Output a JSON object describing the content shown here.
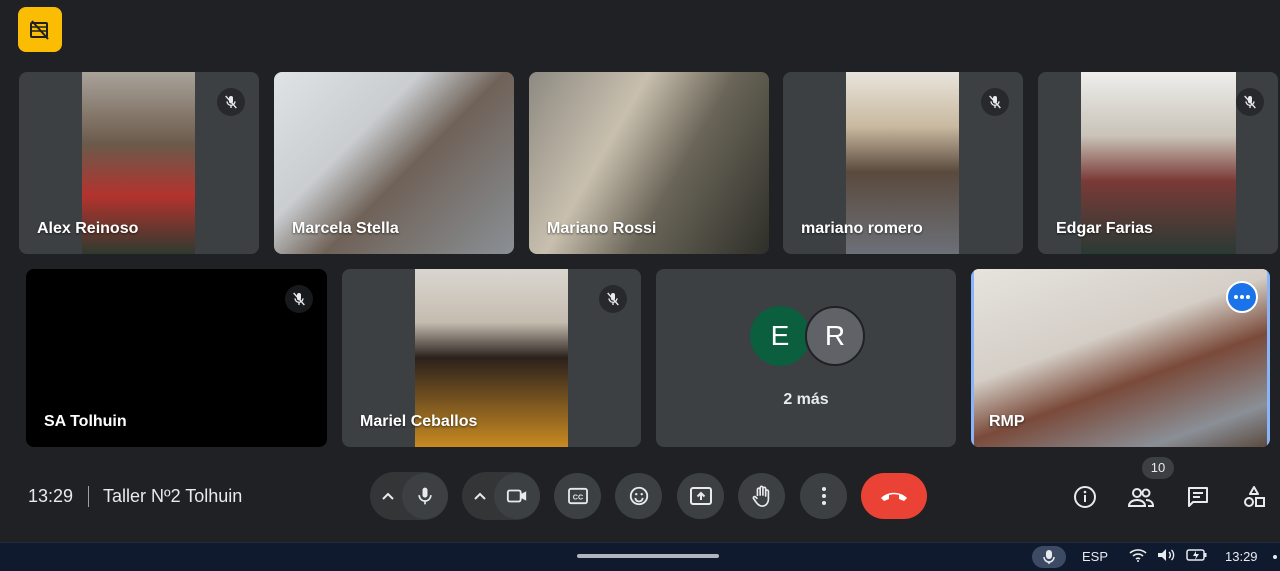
{
  "meeting": {
    "time": "13:29",
    "title": "Taller Nº2 Tolhuin",
    "participant_count": "10"
  },
  "participants_row1": [
    {
      "name": "Alex Reinoso",
      "muted": true
    },
    {
      "name": "Marcela Stella",
      "muted": false
    },
    {
      "name": "Mariano Rossi",
      "muted": false
    },
    {
      "name": "mariano romero",
      "muted": true
    },
    {
      "name": "Edgar Farias",
      "muted": true
    }
  ],
  "participants_row2": [
    {
      "name": "SA Tolhuin",
      "muted": true
    },
    {
      "name": "Mariel Ceballos",
      "muted": true
    },
    {
      "overflow_initials": [
        "E",
        "R"
      ],
      "label": "2 más"
    },
    {
      "name": "RMP",
      "muted": false
    }
  ],
  "colors": {
    "background": "#202124",
    "tile": "#3c4043",
    "accent_blue": "#8ab4f8",
    "end_call_red": "#ea4335",
    "badge_yellow": "#fbbc04",
    "avatar_e": "#0b5e3e",
    "avatar_r": "#3c4043"
  },
  "controls": [
    "mic-button",
    "camera-button",
    "captions-button",
    "emoji-button",
    "present-button",
    "raise-hand-button",
    "more-options-button",
    "end-call-button"
  ],
  "right_controls": [
    "info-icon",
    "people-icon",
    "chat-icon",
    "activities-icon"
  ],
  "taskbar": {
    "language": "ESP",
    "time": "13:29"
  }
}
